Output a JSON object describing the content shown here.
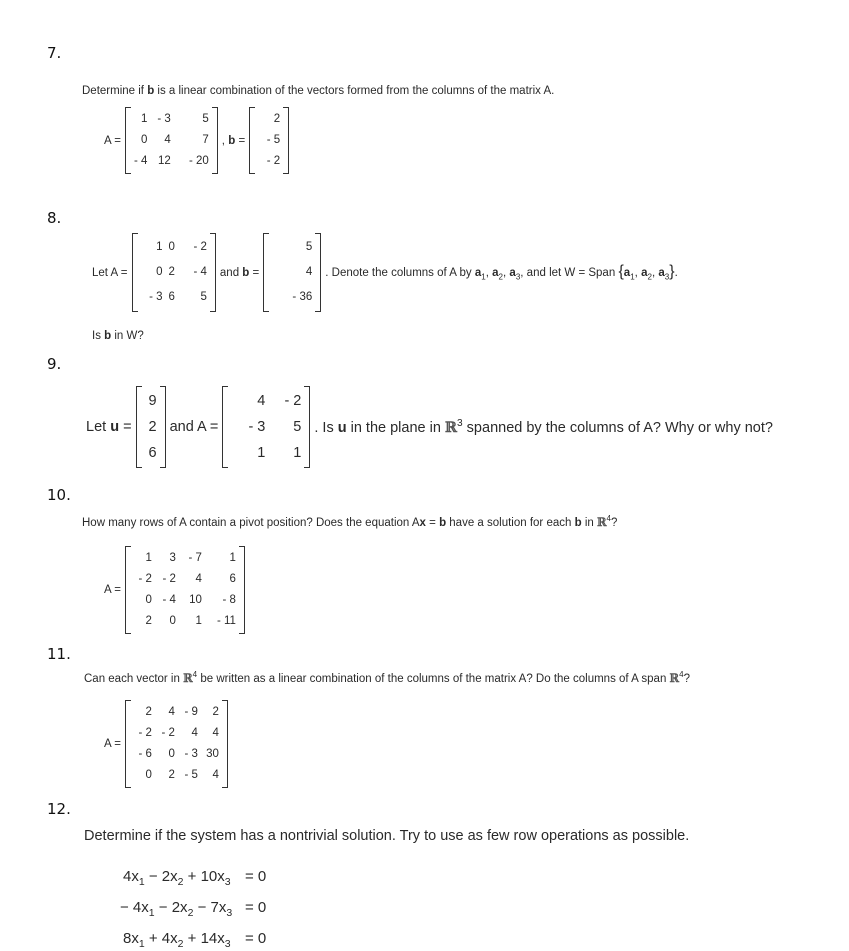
{
  "problems": [
    {
      "number": "7.",
      "prompt_parts": [
        "Determine if ",
        "b",
        " is a linear combination of the vectors formed from the columns of the matrix A."
      ],
      "matrix_A_label": "A =",
      "matrix_A": [
        [
          "1",
          "- 3",
          "5"
        ],
        [
          "0",
          "4",
          "7"
        ],
        [
          "- 4",
          "12",
          "- 20"
        ]
      ],
      "separator": ",",
      "vector_b_label": "b",
      "equals": "=",
      "vector_b": [
        [
          "2"
        ],
        [
          "- 5"
        ],
        [
          "- 2"
        ]
      ]
    },
    {
      "number": "8.",
      "let_label": "Let A =",
      "matrix_A": [
        [
          "1",
          "0",
          "- 2"
        ],
        [
          "0",
          "2",
          "- 4"
        ],
        [
          "- 3",
          "6",
          "5"
        ]
      ],
      "and_label": "and",
      "vector_b_label": "b",
      "equals": "=",
      "vector_b": [
        [
          "5"
        ],
        [
          "4"
        ],
        [
          "- 36"
        ]
      ],
      "trailing_parts": [
        ". Denote the columns of A by ",
        "a",
        "1",
        ", ",
        "a",
        "2",
        ", ",
        "a",
        "3",
        ", and let W = Span ",
        "{",
        "a",
        "1",
        ", ",
        "a",
        "2",
        ", ",
        "a",
        "3",
        "}",
        "."
      ],
      "question_parts": [
        "Is ",
        "b",
        " in W?"
      ]
    },
    {
      "number": "9.",
      "let_label": "Let",
      "vector_u_label": "u",
      "equals": "=",
      "vector_u": [
        [
          "9"
        ],
        [
          "2"
        ],
        [
          "6"
        ]
      ],
      "and_label": "and A =",
      "matrix_A": [
        [
          "4",
          "- 2"
        ],
        [
          "- 3",
          "5"
        ],
        [
          "1",
          "1"
        ]
      ],
      "trailing_parts": [
        ". Is ",
        "u",
        " in the plane in ",
        "ℝ",
        "3",
        " spanned by the columns of A? Why or why not?"
      ]
    },
    {
      "number": "10.",
      "prompt_parts": [
        "How many rows of A contain a pivot position? Does the equation A",
        "x",
        " = ",
        "b",
        " have a solution for each ",
        "b",
        " in ",
        "ℝ",
        "4",
        "?"
      ],
      "matrix_A_label": "A =",
      "matrix_A": [
        [
          "1",
          "3",
          "- 7",
          "1"
        ],
        [
          "- 2",
          "- 2",
          "4",
          "6"
        ],
        [
          "0",
          "- 4",
          "10",
          "- 8"
        ],
        [
          "2",
          "0",
          "1",
          "- 11"
        ]
      ]
    },
    {
      "number": "11.",
      "prompt_parts": [
        "Can each vector in ",
        "ℝ",
        "4",
        " be written as a linear combination of the columns of the matrix A? Do the columns of A span ",
        "ℝ",
        "4",
        "?"
      ],
      "matrix_A_label": "A =",
      "matrix_A": [
        [
          "2",
          "4",
          "- 9",
          "2"
        ],
        [
          "- 2",
          "- 2",
          "4",
          "4"
        ],
        [
          "- 6",
          "0",
          "- 3",
          "30"
        ],
        [
          "0",
          "2",
          "- 5",
          "4"
        ]
      ]
    },
    {
      "number": "12.",
      "prompt": "Determine if the system has a nontrivial solution. Try to use as few row operations as possible.",
      "equations": [
        {
          "lhs": [
            "4x",
            "1",
            " − 2x",
            "2",
            " + 10x",
            "3"
          ],
          "rhs": "=  0"
        },
        {
          "lhs": [
            "− 4x",
            "1",
            " − 2x",
            "2",
            " − 7x",
            "3"
          ],
          "rhs": "=  0"
        },
        {
          "lhs": [
            "8x",
            "1",
            " + 4x",
            "2",
            " + 14x",
            "3"
          ],
          "rhs": "=  0"
        }
      ]
    }
  ]
}
